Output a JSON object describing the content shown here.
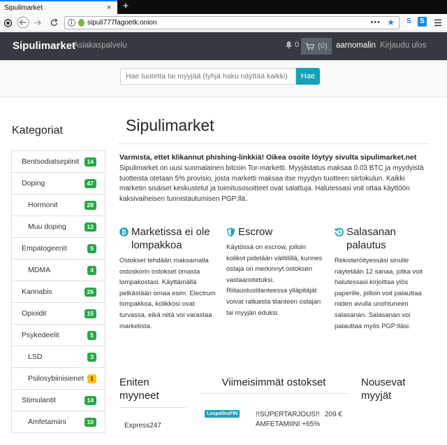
{
  "browser": {
    "tab_title": "Sipulimarket",
    "tab_close": "×",
    "new_tab": "+",
    "url": "sipuli777fagoetk.onion",
    "ext1": "S",
    "ext2": "S"
  },
  "nav": {
    "brand": "Sipulimarket",
    "customer_service": "Asiakaspalvelu",
    "notifications": "0",
    "cart_count": "(0)",
    "username": "aarnomalin",
    "logout": "Kirjaudu ulos"
  },
  "search": {
    "placeholder": "Hae tuotetta tai myyjää (tyhjä haku näyttää kaikki)",
    "button": "Hae"
  },
  "sidebar": {
    "title": "Kategoriat",
    "categories": [
      {
        "label": "Bentsodiatsepiinit",
        "count": "14",
        "sub": false
      },
      {
        "label": "Doping",
        "count": "47",
        "sub": false
      },
      {
        "label": "Hormonit",
        "count": "28",
        "sub": true
      },
      {
        "label": "Muu doping",
        "count": "12",
        "sub": true
      },
      {
        "label": "Empatogeenit",
        "count": "5",
        "sub": false
      },
      {
        "label": "MDMA",
        "count": "4",
        "sub": true
      },
      {
        "label": "Kannabis",
        "count": "26",
        "sub": false
      },
      {
        "label": "Opioidit",
        "count": "15",
        "sub": false
      },
      {
        "label": "Psykedeelit",
        "count": "5",
        "sub": false
      },
      {
        "label": "LSD",
        "count": "3",
        "sub": true
      },
      {
        "label": "Psilosybiinisienet",
        "count": "1",
        "sub": true,
        "warn": true
      },
      {
        "label": "Stimulantit",
        "count": "14",
        "sub": false
      },
      {
        "label": "Amfetamiini",
        "count": "10",
        "sub": true
      }
    ]
  },
  "main": {
    "title": "Sipulimarket",
    "warning": "Varmista, ettet klikannut phishing-linkkiä! Oikea osoite löytyy sivulta sipulimarket.net",
    "intro": "Sipulimarket on uusi suomalainen bitcoin Tor-marketti. Myyjästatus maksaa 0.03 BTC ja myydyistä tuotteista otetaan 5% provisio, josta marketti maksaa itse myydyn tuotteen siirtokulun. Kaikki marketin sisäiset keskustelut ja toimitusosoitteet ovat salattuja. Halutessasi voit ottaa käyttöön kaksivaiheisen tunnistautumisen PGP:llä.",
    "features": [
      {
        "icon": "bitcoin-icon",
        "title": "Marketissa ei ole lompakkoa",
        "body": "Ostokset tehdään maksamalla ostoskorin ostokset omasta lompakostasi. Käyttämällä pelkästään omaa esim. Electrum lompakkoa, kolikkosi ovat turvassa, eikä niitä voi varastaa marketista."
      },
      {
        "icon": "shield-icon",
        "title": "Escrow",
        "body": "Käytössä on escrow, jolloin kolikot pidetään välitilillä, kunnes ostaja on merkinnyt ostoksen vastaanotetuksi. Riitaustustilanteessa ylläpitäjät voivat ratkaista tilanteen ostajan tai myyjän eduksi."
      },
      {
        "icon": "history-icon",
        "title": "Salasanan palautus",
        "body": "Rekisteröityessäsi sinulle näytetään 12 sanaa, jotka voit halutessasi kirjoittaa ylös paperille, jolloin voit palauttaa niiden avulla unohtuneen salasanan. Salasanan voi palauttaa myös PGP:lläsi."
      }
    ],
    "top_sellers": {
      "title": "Eniten myyneet",
      "items": [
        "Express247"
      ]
    },
    "recent": {
      "title": "Viimeisimmät ostokset",
      "items": [
        {
          "seller": "LospollosFIN",
          "product": "!!SUPERTARJOUS!! AMFETAMIINI +65%",
          "price": "209 €"
        }
      ]
    },
    "rising": {
      "title": "Nousevat myyjät"
    }
  },
  "colors": {
    "nav_bg": "#343a40",
    "search_btn": "#17a2b8",
    "badge": "#28a745",
    "badge_warn": "#ffc107",
    "feature_icon": "#17a2b8"
  }
}
